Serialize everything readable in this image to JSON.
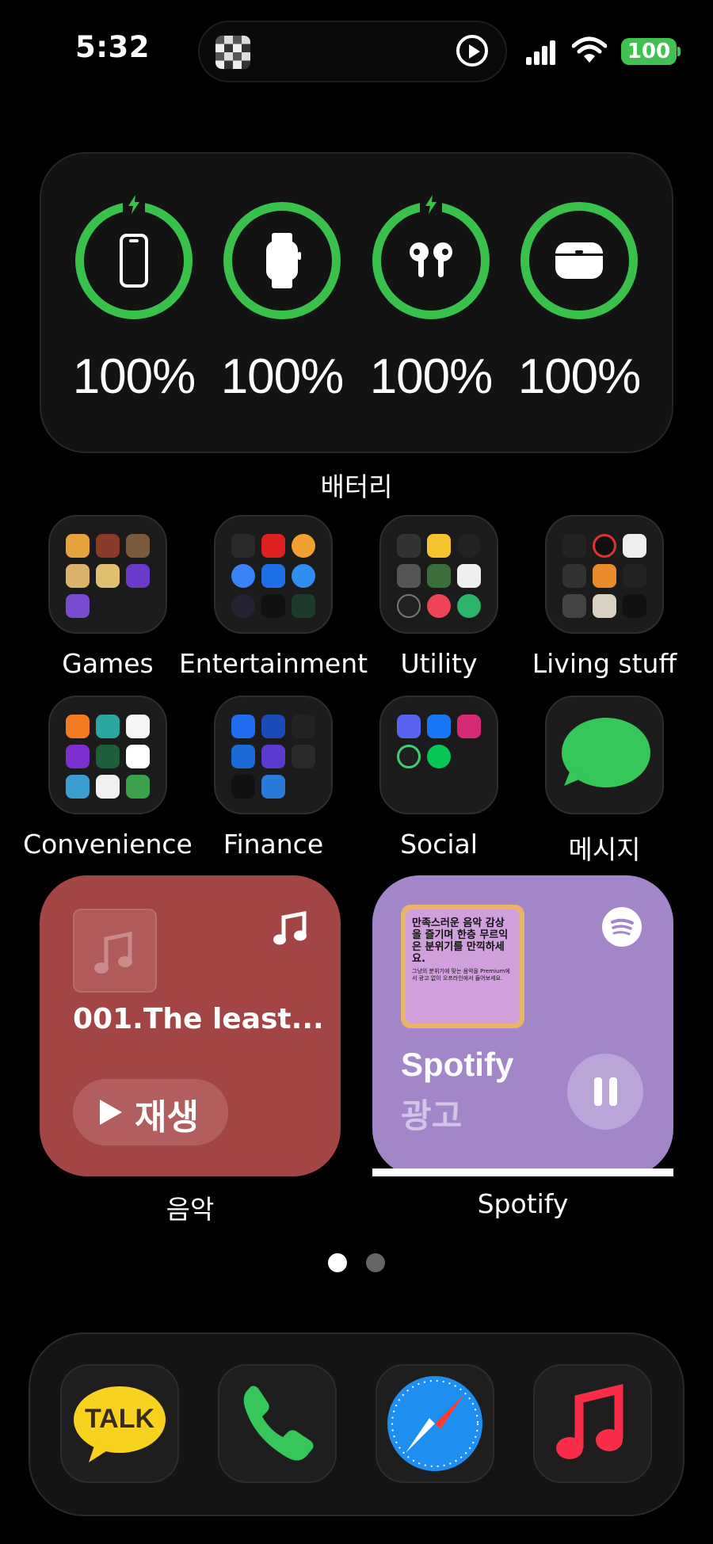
{
  "status_bar": {
    "time": "5:32",
    "battery_level": "100",
    "signal_icon": "cellular-signal-icon",
    "wifi_icon": "wifi-icon",
    "live_activity_icon": "play-circle-icon"
  },
  "battery_widget": {
    "devices": [
      {
        "device": "iphone-icon",
        "percent": "100%",
        "charging": true
      },
      {
        "device": "apple-watch-icon",
        "percent": "100%",
        "charging": false
      },
      {
        "device": "airpods-icon",
        "percent": "100%",
        "charging": true
      },
      {
        "device": "airpods-case-icon",
        "percent": "100%",
        "charging": false
      }
    ],
    "ring_color": "#39c24a",
    "label": "배터리"
  },
  "folders": [
    {
      "label": "Games"
    },
    {
      "label": "Entertainment"
    },
    {
      "label": "Utility"
    },
    {
      "label": "Living stuff"
    },
    {
      "label": "Convenience"
    },
    {
      "label": "Finance"
    },
    {
      "label": "Social"
    },
    {
      "label": "메시지"
    }
  ],
  "music_widget": {
    "track": "001.The least...",
    "play_label": "재생",
    "label": "음악",
    "color": "#a34545"
  },
  "spotify_widget": {
    "ad_text": "만족스러운 음악 감상을 즐기며 한층 무르익은 분위기를 만끽하세요.",
    "ad_small_text": "그냥의 분위기에 맞는 음악을 Premium에서 광고 없이 오프라인에서 들어보세요.",
    "title": "Spotify",
    "subtitle": "광고",
    "label": "Spotify",
    "color": "#a386c8"
  },
  "page_indicator": {
    "pages": 2,
    "current": 1
  },
  "dock": [
    {
      "app": "kakaotalk-icon",
      "text": "TALK"
    },
    {
      "app": "phone-icon"
    },
    {
      "app": "safari-icon"
    },
    {
      "app": "music-icon"
    }
  ]
}
